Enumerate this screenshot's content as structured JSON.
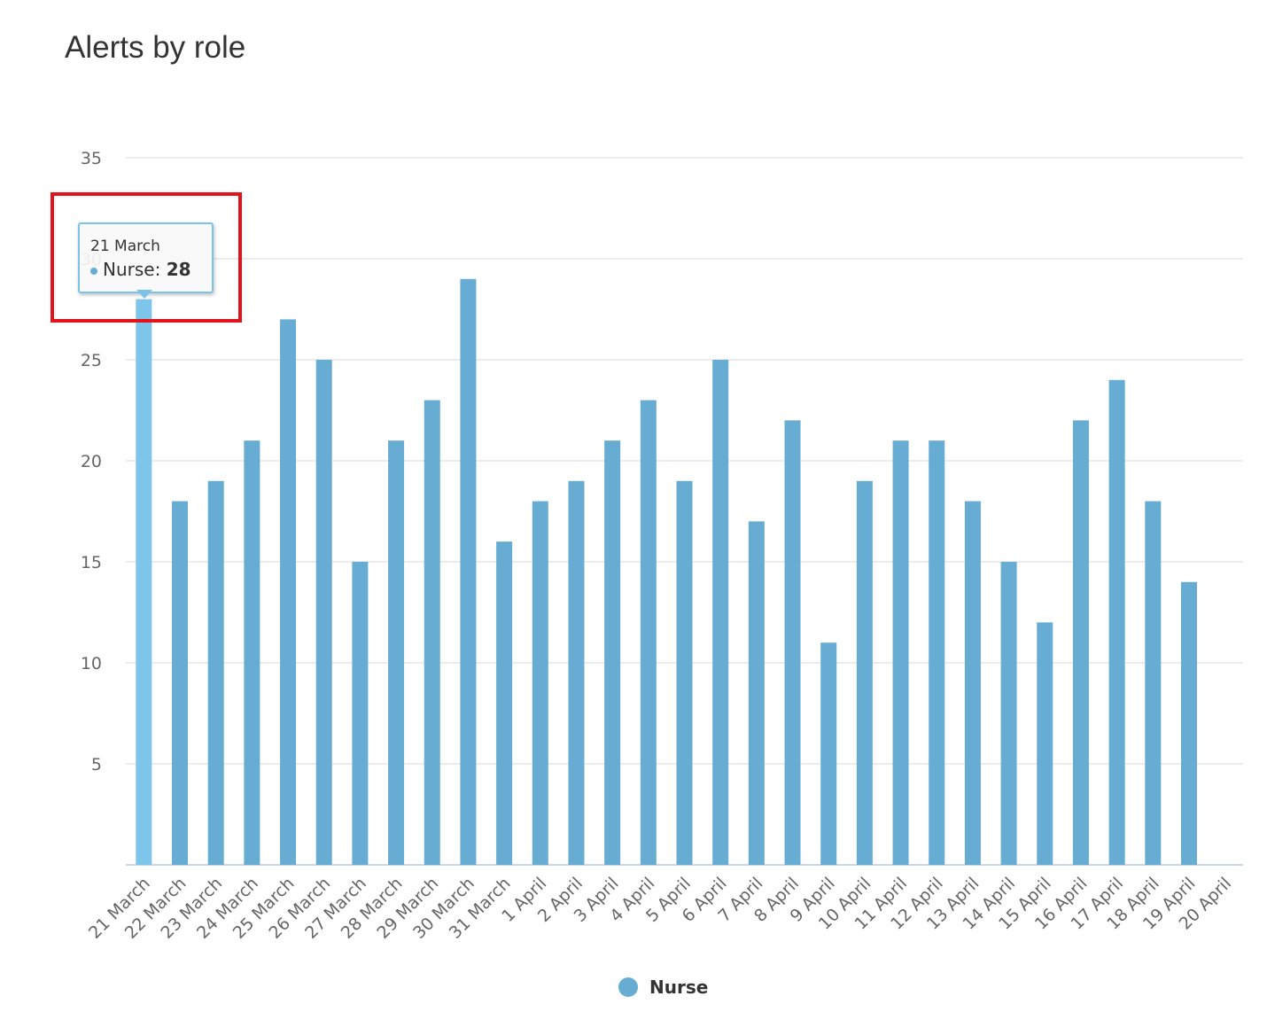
{
  "chart_data": {
    "type": "bar",
    "title": "Alerts by role",
    "categories": [
      "21 March",
      "22 March",
      "23 March",
      "24 March",
      "25 March",
      "26 March",
      "27 March",
      "28 March",
      "29 March",
      "30 March",
      "31 March",
      "1 April",
      "2 April",
      "3 April",
      "4 April",
      "5 April",
      "6 April",
      "7 April",
      "8 April",
      "9 April",
      "10 April",
      "11 April",
      "12 April",
      "13 April",
      "14 April",
      "15 April",
      "16 April",
      "17 April",
      "18 April",
      "19 April",
      "20 April"
    ],
    "series": [
      {
        "name": "Nurse",
        "values": [
          28,
          18,
          19,
          21,
          27,
          25,
          15,
          21,
          23,
          29,
          16,
          18,
          19,
          21,
          23,
          19,
          25,
          17,
          22,
          11,
          19,
          21,
          21,
          18,
          15,
          12,
          22,
          24,
          18,
          14,
          0
        ]
      }
    ],
    "ylim": [
      0,
      35
    ],
    "yticks": [
      5,
      10,
      15,
      20,
      25,
      30,
      35
    ],
    "grid": true,
    "legend": "bottom-center",
    "colors": {
      "bar": "#67acd3",
      "bar_hover": "#7dc5ea",
      "grid": "#e6e6e6",
      "axis": "#ccd6eb",
      "highlight": "#e0141a"
    }
  },
  "tooltip": {
    "date": "21 March",
    "series": "Nurse",
    "value": "28"
  }
}
